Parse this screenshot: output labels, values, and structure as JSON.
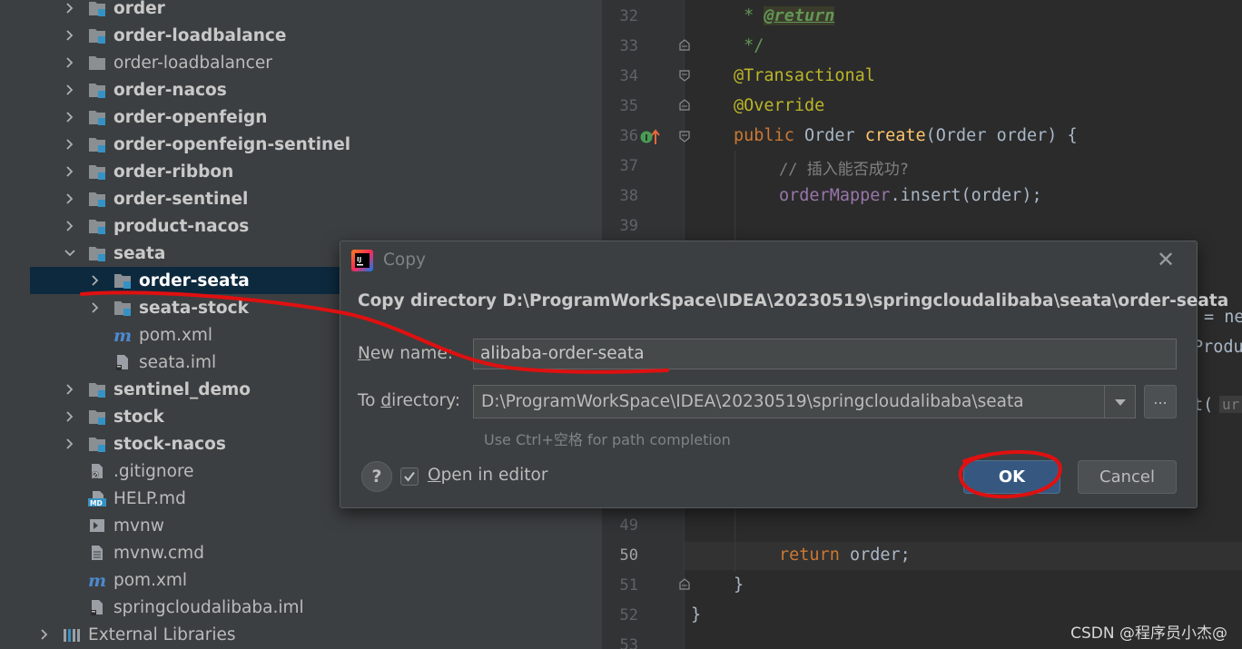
{
  "tree": {
    "items": [
      {
        "label": "order",
        "icon": "module-folder-icon",
        "arrow": "right",
        "bold": true
      },
      {
        "label": "order-loadbalance",
        "icon": "module-folder-icon",
        "arrow": "right",
        "bold": true
      },
      {
        "label": "order-loadbalancer",
        "icon": "folder-icon",
        "arrow": "right",
        "bold": false
      },
      {
        "label": "order-nacos",
        "icon": "module-folder-icon",
        "arrow": "right",
        "bold": true
      },
      {
        "label": "order-openfeign",
        "icon": "module-folder-icon",
        "arrow": "right",
        "bold": true
      },
      {
        "label": "order-openfeign-sentinel",
        "icon": "module-folder-icon",
        "arrow": "right",
        "bold": true
      },
      {
        "label": "order-ribbon",
        "icon": "module-folder-icon",
        "arrow": "right",
        "bold": true
      },
      {
        "label": "order-sentinel",
        "icon": "module-folder-icon",
        "arrow": "right",
        "bold": true
      },
      {
        "label": "product-nacos",
        "icon": "module-folder-icon",
        "arrow": "right",
        "bold": true
      },
      {
        "label": "seata",
        "icon": "module-folder-icon",
        "arrow": "down",
        "bold": true
      },
      {
        "label": "order-seata",
        "icon": "module-folder-icon",
        "arrow": "right",
        "bold": true,
        "selected": true,
        "indent": 1
      },
      {
        "label": "seata-stock",
        "icon": "module-folder-icon",
        "arrow": "right",
        "bold": true,
        "indent": 1
      },
      {
        "label": "pom.xml",
        "icon": "maven-icon",
        "arrow": "",
        "bold": false,
        "indent": 1
      },
      {
        "label": "seata.iml",
        "icon": "iml-file-icon",
        "arrow": "",
        "bold": false,
        "indent": 1
      },
      {
        "label": "sentinel_demo",
        "icon": "module-folder-icon",
        "arrow": "right",
        "bold": true
      },
      {
        "label": "stock",
        "icon": "module-folder-icon",
        "arrow": "right",
        "bold": true
      },
      {
        "label": "stock-nacos",
        "icon": "module-folder-icon",
        "arrow": "right",
        "bold": true
      },
      {
        "label": ".gitignore",
        "icon": "gitignore-file-icon",
        "arrow": "",
        "bold": false
      },
      {
        "label": "HELP.md",
        "icon": "markdown-file-icon",
        "arrow": "",
        "bold": false
      },
      {
        "label": "mvnw",
        "icon": "shell-script-icon",
        "arrow": "",
        "bold": false
      },
      {
        "label": "mvnw.cmd",
        "icon": "text-file-icon",
        "arrow": "",
        "bold": false
      },
      {
        "label": "pom.xml",
        "icon": "maven-icon",
        "arrow": "",
        "bold": false
      },
      {
        "label": "springcloudalibaba.iml",
        "icon": "iml-file-icon",
        "arrow": "",
        "bold": false
      },
      {
        "label": "External Libraries",
        "icon": "libraries-icon",
        "arrow": "right",
        "bold": false,
        "indent": -1
      }
    ]
  },
  "editor": {
    "line_numbers": [
      "32",
      "33",
      "34",
      "35",
      "36",
      "37",
      "38",
      "39",
      "49",
      "50",
      "51",
      "52",
      "53"
    ],
    "current_line": "50",
    "lines": {
      "l32_star": " * ",
      "l32_tag": "@return",
      "l33": " */",
      "l34": "@Transactional",
      "l35": "@Override",
      "l36_kw": "public ",
      "l36_type": "Order ",
      "l36_fn": "create",
      "l36_rest": "(Order order) {",
      "l37": "// 插入能否成功?",
      "l38_field": "orderMapper",
      "l38_rest": ".insert(order);",
      "l50_kw": "return ",
      "l50_rest": "order;",
      "l51": "}",
      "l52": "}",
      "frag_eq": "= ne",
      "frag_produ": "Produ",
      "frag_t": "t(",
      "frag_ur": "ur"
    }
  },
  "dialog": {
    "title": "Copy",
    "description": "Copy directory D:\\ProgramWorkSpace\\IDEA\\20230519\\springcloudalibaba\\seata\\order-seata",
    "new_name_label_mnemonic": "N",
    "new_name_label_rest": "ew name:",
    "new_name_value": "alibaba-order-seata",
    "to_dir_label_pre": "To ",
    "to_dir_label_mnemonic": "d",
    "to_dir_label_rest": "irectory:",
    "to_dir_value": "D:\\ProgramWorkSpace\\IDEA\\20230519\\springcloudalibaba\\seata",
    "browse_label": "...",
    "hint": "Use Ctrl+空格 for path completion",
    "help_label": "?",
    "open_in_editor_mnemonic": "O",
    "open_in_editor_rest": "pen in editor",
    "open_in_editor_checked": true,
    "ok_label": "OK",
    "cancel_label": "Cancel"
  },
  "watermark": "CSDN @程序员小杰@",
  "colors": {
    "keyword": "#cc7832",
    "annotation": "#bbb529",
    "function": "#ffc66d",
    "comment": "#808080",
    "javadoc": "#629755",
    "field": "#9876aa",
    "selection": "#0d293e",
    "ok_button": "#365880",
    "annotation_red": "#e01010"
  }
}
